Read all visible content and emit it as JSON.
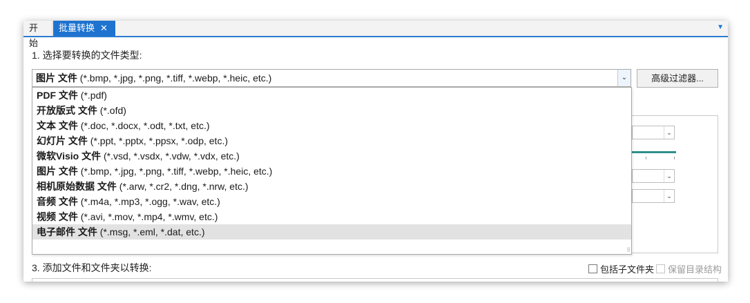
{
  "tabs": [
    {
      "label": "开始",
      "active": false
    },
    {
      "label": "批量转换",
      "active": true,
      "close": "✕"
    }
  ],
  "tab_menu_glyph": "▼",
  "step1": {
    "label": "1. 选择要转换的文件类型:"
  },
  "combo": {
    "selected_bold": "图片 文件",
    "selected_ext": " (*.bmp, *.jpg, *.png, *.tiff, *.webp, *.heic, etc.)",
    "arrow_glyph": "⌄"
  },
  "advanced_filter_label": "高级过滤器...",
  "options": [
    {
      "bold": "PDF 文件",
      "ext": " (*.pdf)"
    },
    {
      "bold": "开放版式 文件",
      "ext": " (*.ofd)"
    },
    {
      "bold": "文本 文件",
      "ext": " (*.doc, *.docx, *.odt, *.txt, etc.)"
    },
    {
      "bold": "幻灯片 文件",
      "ext": " (*.ppt, *.pptx, *.ppsx, *.odp, etc.)"
    },
    {
      "bold": "微软Visio 文件",
      "ext": " (*.vsd, *.vsdx, *.vdw, *.vdx, etc.)"
    },
    {
      "bold": "图片 文件",
      "ext": " (*.bmp, *.jpg, *.png, *.tiff, *.webp, *.heic, etc.)"
    },
    {
      "bold": "相机原始数据 文件",
      "ext": " (*.arw, *.cr2, *.dng, *.nrw, etc.)"
    },
    {
      "bold": "音频 文件",
      "ext": " (*.m4a, *.mp3, *.ogg, *.wav, etc.)"
    },
    {
      "bold": "视频 文件",
      "ext": " (*.avi, *.mov, *.mp4, *.wmv, etc.)"
    },
    {
      "bold": "电子邮件 文件",
      "ext": " (*.msg, *.eml, *.dat, etc.)",
      "highlighted": true
    }
  ],
  "step3": {
    "label": "3. 添加文件和文件夹以转换:"
  },
  "include_subfolders": {
    "label": "包括子文件夹",
    "checked": false,
    "enabled": true
  },
  "keep_structure": {
    "label": "保留目录结构",
    "checked": false,
    "enabled": false
  }
}
